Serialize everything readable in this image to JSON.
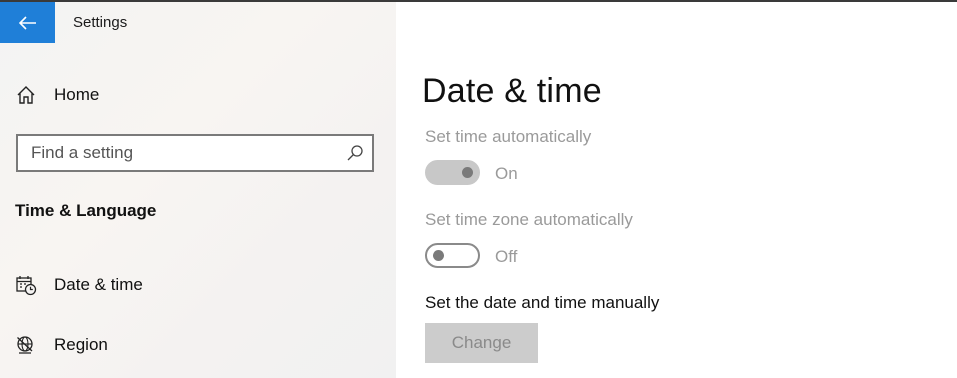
{
  "window": {
    "title": "Settings"
  },
  "sidebar": {
    "home_label": "Home",
    "search_placeholder": "Find a setting",
    "section_title": "Time & Language",
    "items": [
      {
        "label": "Date & time",
        "icon": "calendar-clock-icon"
      },
      {
        "label": "Region",
        "icon": "globe-icon"
      }
    ]
  },
  "main": {
    "title": "Date & time",
    "set_time_auto": {
      "label": "Set time automatically",
      "state": "On"
    },
    "set_zone_auto": {
      "label": "Set time zone automatically",
      "state": "Off"
    },
    "manual": {
      "label": "Set the date and time manually",
      "button": "Change"
    }
  },
  "colors": {
    "accent": "#1f7fd8",
    "disabled_text": "#9a9a9a",
    "sidebar_bg": "#f3f3f3"
  }
}
